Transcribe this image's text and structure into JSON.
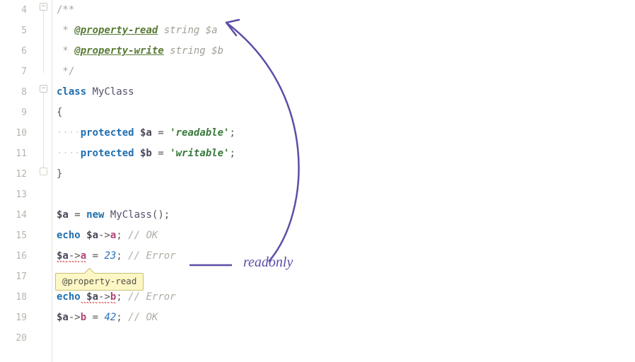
{
  "gutter": {
    "start": 4,
    "end": 20
  },
  "code": {
    "l4": {
      "delim": "/**"
    },
    "l5": {
      "star": " * ",
      "tag": "@property-read",
      "type": " string ",
      "var": "$a"
    },
    "l6": {
      "star": " * ",
      "tag": "@property-write",
      "type": " string ",
      "var": "$b"
    },
    "l7": {
      "delim": " */"
    },
    "l8": {
      "kw": "class",
      "name": " MyClass"
    },
    "l9": {
      "brace": "{"
    },
    "l10": {
      "ws": "    ",
      "kw": "protected",
      "var": " $a",
      "eq": " = ",
      "str": "'readable'",
      "semi": ";"
    },
    "l11": {
      "ws": "    ",
      "kw": "protected",
      "var": " $b",
      "eq": " = ",
      "str": "'writable'",
      "semi": ";"
    },
    "l12": {
      "brace": "}"
    },
    "l14": {
      "var": "$a",
      "eq": " = ",
      "kw": "new",
      "cls": " MyClass",
      "paren": "();"
    },
    "l15": {
      "kw": "echo",
      "var": " $a",
      "arrow": "->",
      "prop": "a",
      "semi": ";",
      "cmt": " // OK"
    },
    "l16": {
      "var": "$a",
      "arrow": "->",
      "prop": "a",
      "eq": " = ",
      "num": "23",
      "semi": ";",
      "cmt": " // Error"
    },
    "l18": {
      "kw": "echo",
      "var": " $a",
      "arrow": "->",
      "propErr": "b",
      "semi": ";",
      "cmt": " // Error"
    },
    "l19": {
      "var": "$a",
      "arrow": "->",
      "prop": "b",
      "eq": " = ",
      "num": "42",
      "semi": ";",
      "cmt": " // OK"
    }
  },
  "tooltip": {
    "text": "@property-read"
  },
  "annotation": {
    "text": "readonly"
  }
}
